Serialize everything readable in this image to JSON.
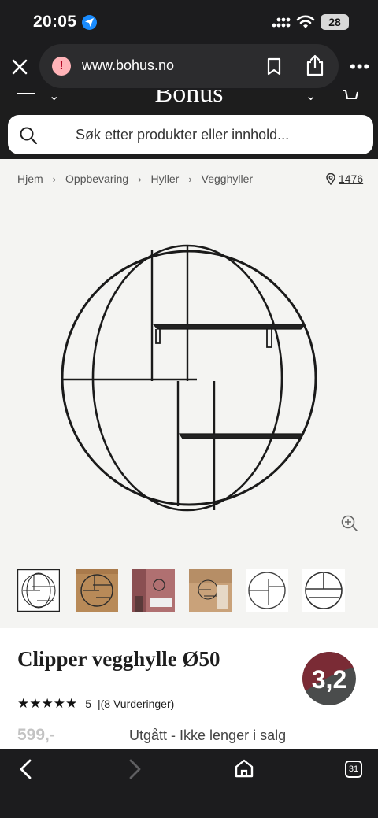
{
  "status_bar": {
    "time": "20:05",
    "battery": "28"
  },
  "browser": {
    "url": "www.bohus.no",
    "warning_symbol": "!"
  },
  "site": {
    "brand": "Bohus"
  },
  "search": {
    "placeholder": "Søk etter produkter eller innhold..."
  },
  "breadcrumb": [
    "Hjem",
    "Oppbevaring",
    "Hyller",
    "Vegghyller"
  ],
  "store_number": "1476",
  "product": {
    "title": "Clipper vegghylle Ø50",
    "rating_count": "5",
    "reviews_link": "(8 Vurderinger)",
    "price": "599,-",
    "availability": "Utgått - Ikke lenger i salg",
    "badge_value": "3,2"
  },
  "toolbar": {
    "tabs_count": "31"
  },
  "icons": [
    "location-arrow-icon",
    "signal-icon",
    "wifi-icon",
    "close-icon",
    "warning-icon",
    "bookmark-icon",
    "share-icon",
    "more-icon",
    "menu-icon",
    "cart-icon",
    "search-icon",
    "map-pin-icon",
    "zoom-in-icon",
    "back-icon",
    "forward-icon",
    "home-icon",
    "tabs-icon"
  ],
  "colors": {
    "badge_top": "#7a2b35",
    "badge_bottom": "#4a4c4c",
    "browser_chrome": "#1c1c1e",
    "warning_bg": "#ffb3b8",
    "location_blue": "#1a8cff"
  }
}
